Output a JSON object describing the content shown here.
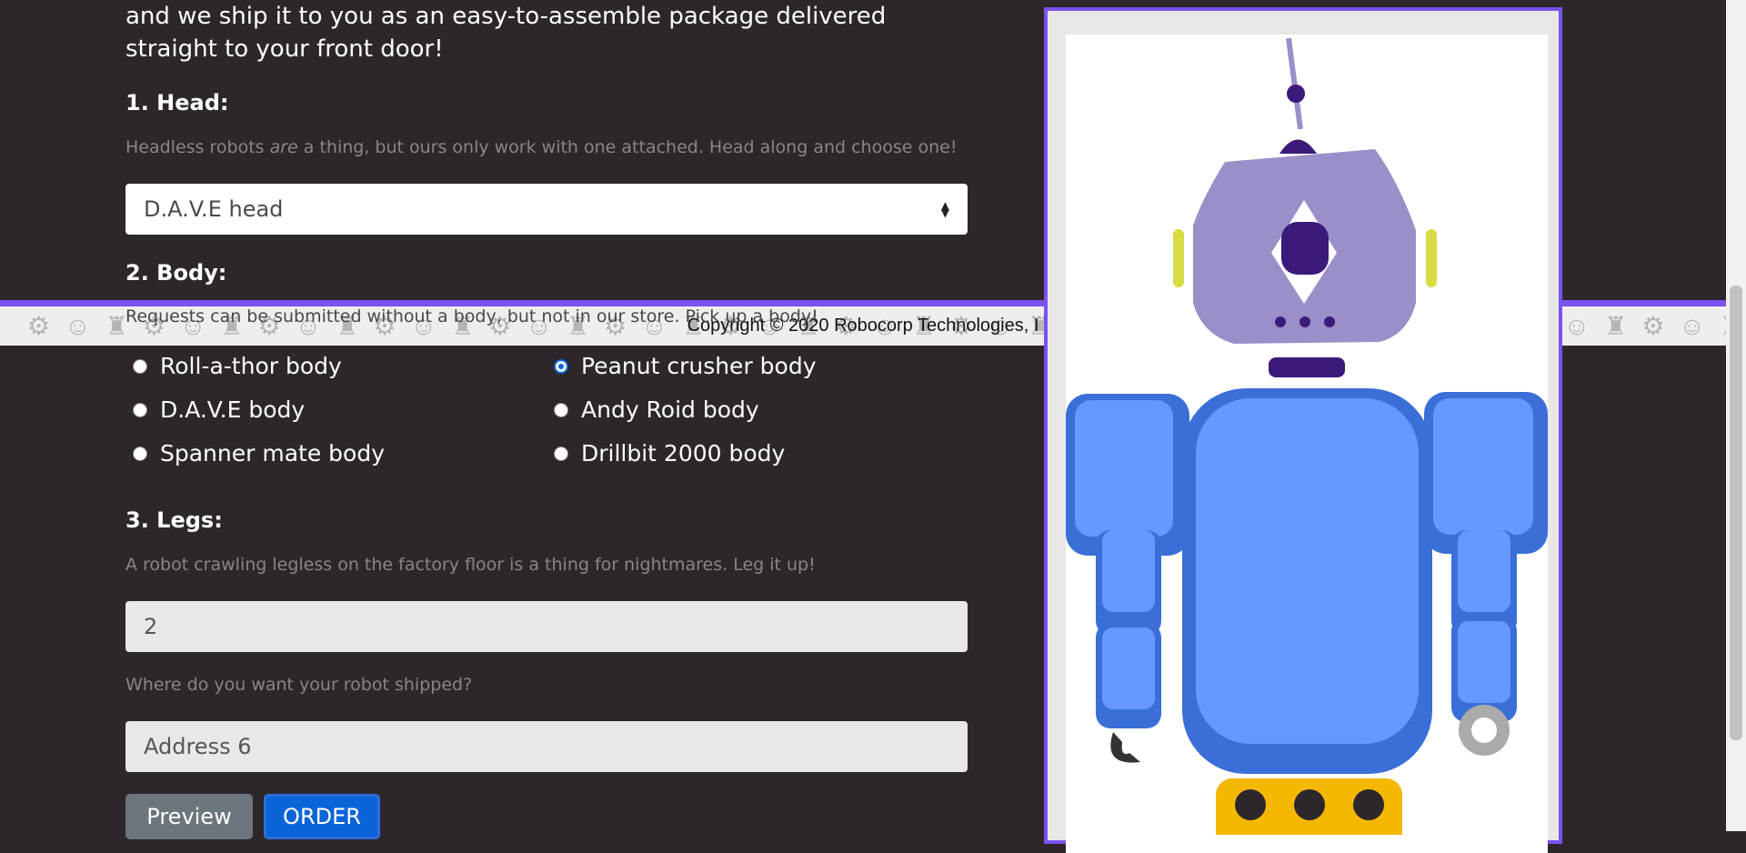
{
  "intro_text": "and we ship it to you as an easy-to-assemble package delivered straight to your front door!",
  "head": {
    "title": "1. Head:",
    "hint_before": "Headless robots ",
    "hint_em": "are",
    "hint_after": " a thing, but ours only work with one attached. Head along and choose one!",
    "selected": "D.A.V.E head"
  },
  "body": {
    "title": "2. Body:",
    "hint": "Requests can be submitted without a body, but not in our store. Pick up a body!",
    "options": [
      {
        "label": "Roll-a-thor body",
        "checked": false
      },
      {
        "label": "Peanut crusher body",
        "checked": true
      },
      {
        "label": "D.A.V.E body",
        "checked": false
      },
      {
        "label": "Andy Roid body",
        "checked": false
      },
      {
        "label": "Spanner mate body",
        "checked": false
      },
      {
        "label": "Drillbit 2000 body",
        "checked": false
      }
    ]
  },
  "legs": {
    "title": "3. Legs:",
    "hint": "A robot crawling legless on the factory floor is a thing for nightmares. Leg it up!",
    "value": "2"
  },
  "address": {
    "label": "Where do you want your robot shipped?",
    "value": "Address 6"
  },
  "buttons": {
    "preview": "Preview",
    "order": "ORDER"
  },
  "footer": {
    "text": "Copyright © 2020 Robocorp Technologies, I"
  },
  "colors": {
    "background": "#2d272c",
    "accent": "#7b52f0",
    "primary": "#0a64d8",
    "robot_head": "#9b8fc9",
    "robot_body": "#3a6fd8",
    "robot_legs": "#f5b800"
  }
}
